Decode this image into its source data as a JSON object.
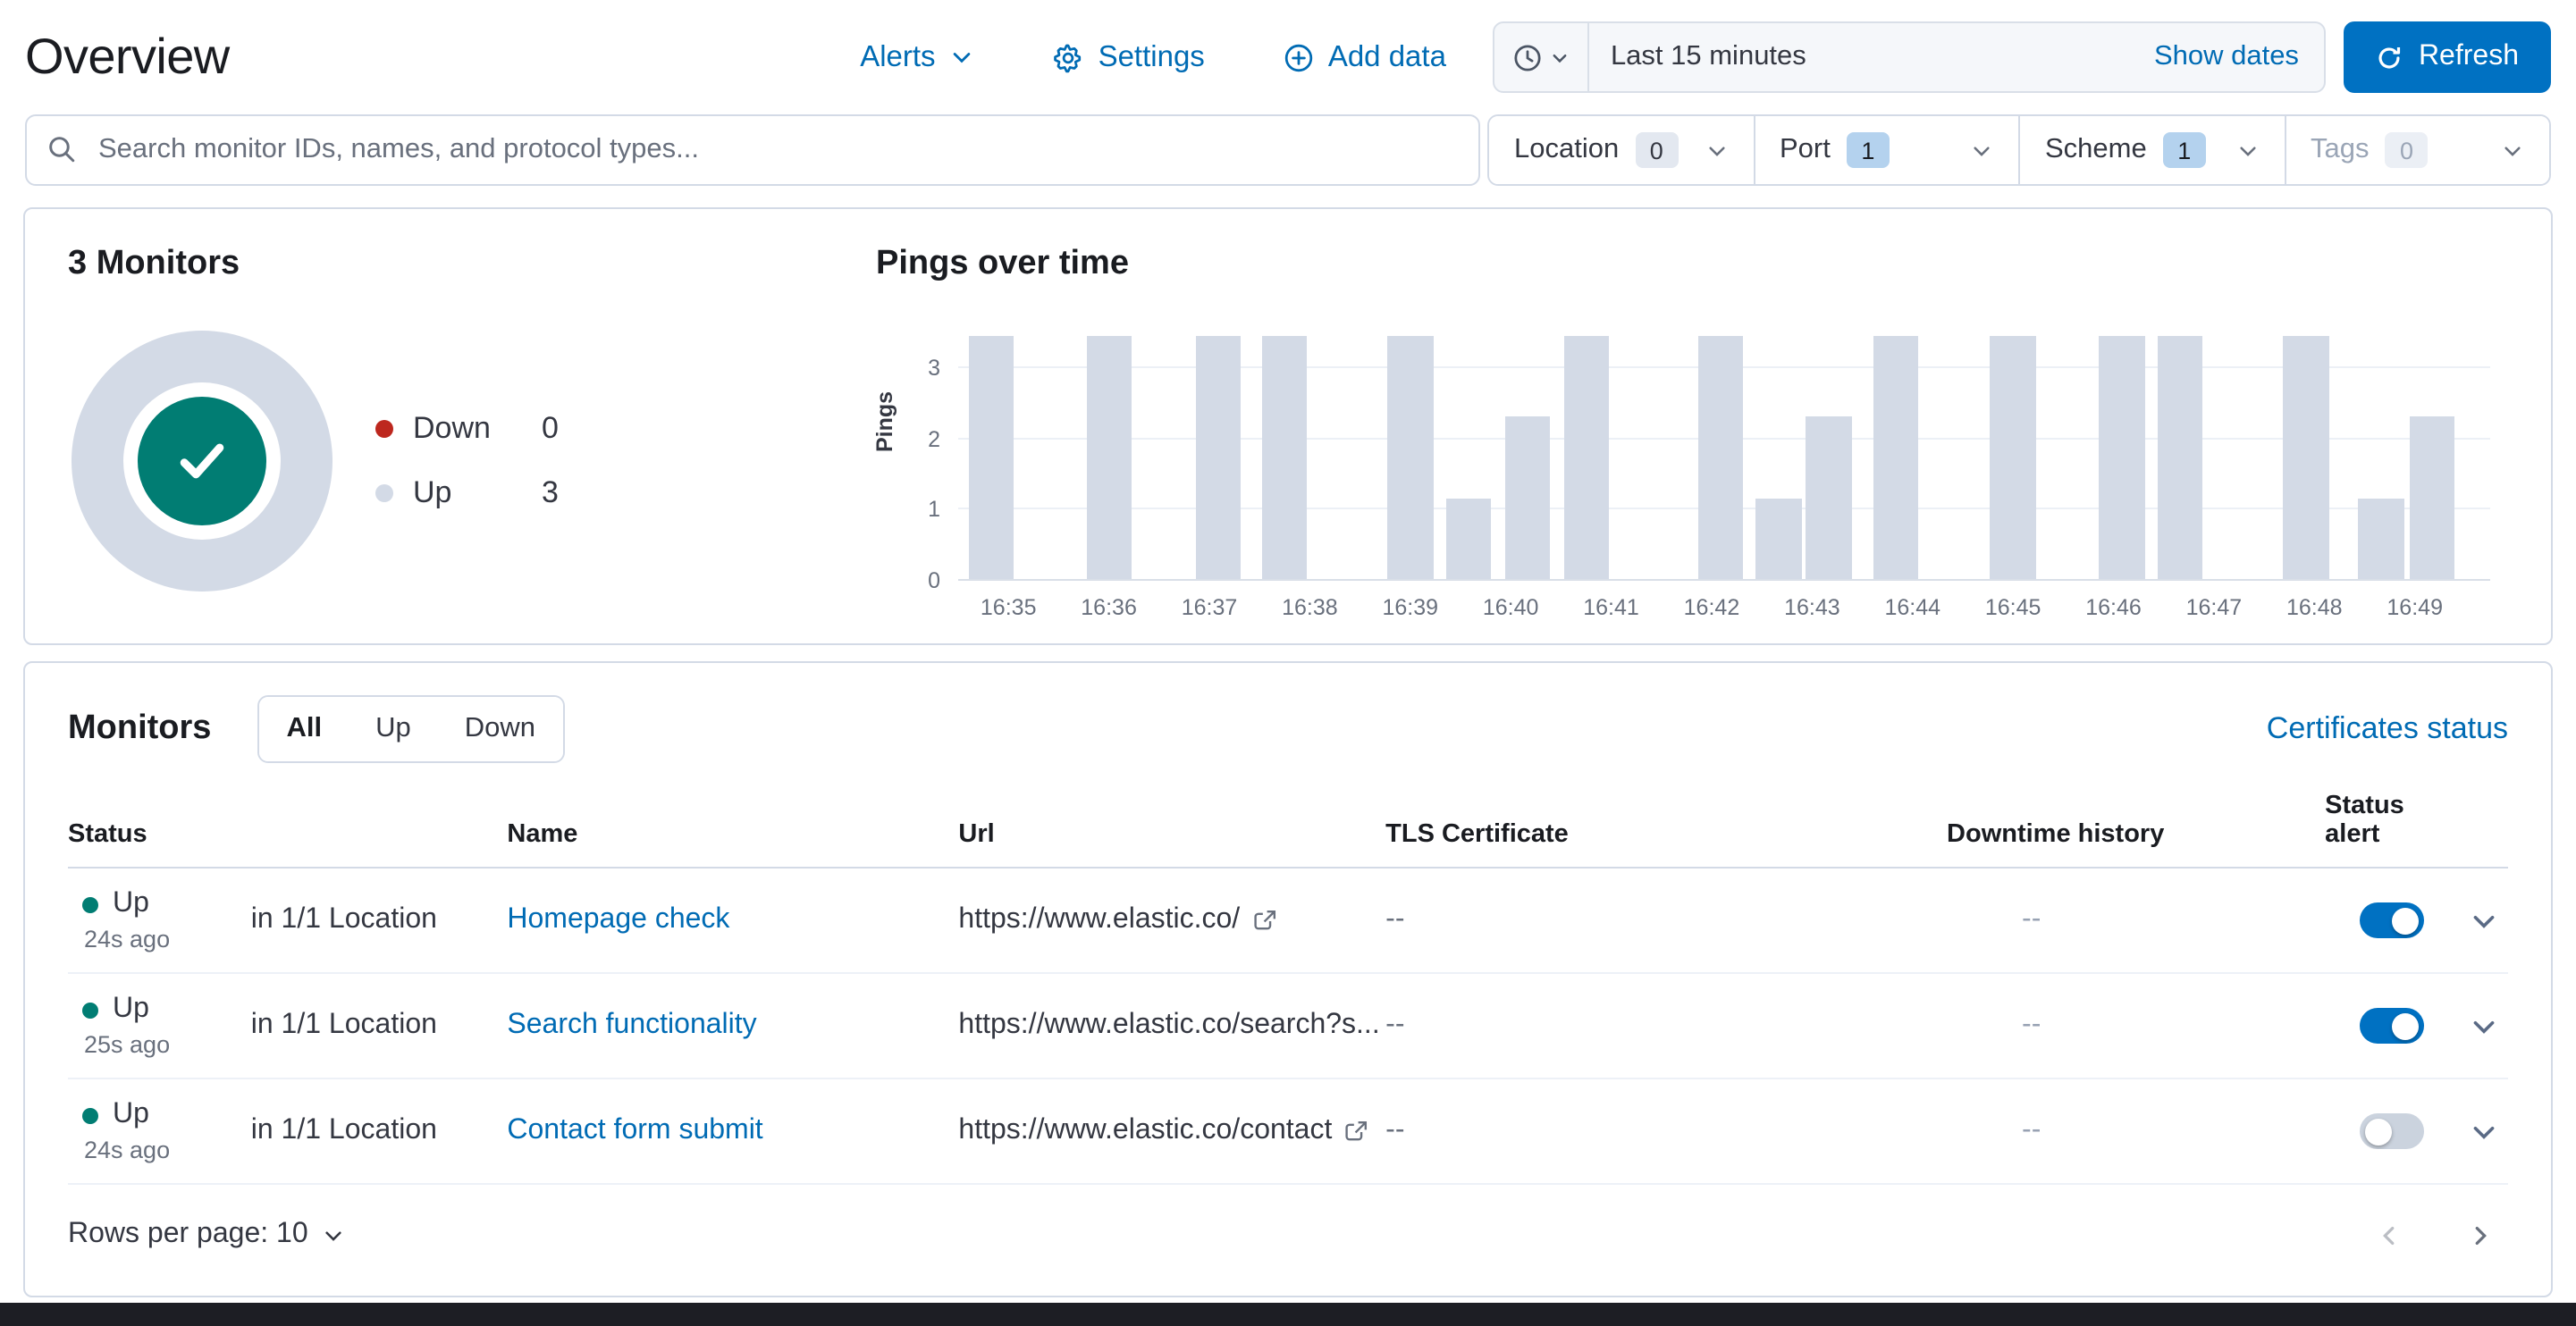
{
  "header": {
    "title": "Overview",
    "alerts_label": "Alerts",
    "settings_label": "Settings",
    "add_data_label": "Add data",
    "time_range": "Last 15 minutes",
    "show_dates_label": "Show dates",
    "refresh_label": "Refresh"
  },
  "search": {
    "placeholder": "Search monitor IDs, names, and protocol types..."
  },
  "filters": [
    {
      "label": "Location",
      "count": "0",
      "active": false,
      "disabled": false
    },
    {
      "label": "Port",
      "count": "1",
      "active": true,
      "disabled": false
    },
    {
      "label": "Scheme",
      "count": "1",
      "active": true,
      "disabled": false
    },
    {
      "label": "Tags",
      "count": "0",
      "active": false,
      "disabled": true
    }
  ],
  "snapshot": {
    "title": "3 Monitors",
    "status_icon": "check-in-circle",
    "status_color": "#017D73",
    "legend": [
      {
        "label": "Down",
        "value": "0",
        "color": "#BD271E"
      },
      {
        "label": "Up",
        "value": "3",
        "color": "#D3DAE6"
      }
    ]
  },
  "chart_data": {
    "type": "bar",
    "title": "Pings over time",
    "ylabel": "Pings",
    "xlabel": "",
    "yticks": [
      0,
      1,
      2,
      3
    ],
    "ylim": [
      0,
      3.43
    ],
    "bar_ylim": 3.0,
    "bar_width_seconds": 27,
    "bar_color": "#D3DAE6",
    "grid": true,
    "x_domain": [
      "16:34:30",
      "16:49:45"
    ],
    "xticks": [
      "16:35",
      "16:36",
      "16:37",
      "16:38",
      "16:39",
      "16:40",
      "16:41",
      "16:42",
      "16:43",
      "16:44",
      "16:45",
      "16:46",
      "16:47",
      "16:48",
      "16:49"
    ],
    "bars": [
      {
        "t": "16:34:50",
        "v": 3
      },
      {
        "t": "16:36:00",
        "v": 3
      },
      {
        "t": "16:37:05",
        "v": 3
      },
      {
        "t": "16:37:45",
        "v": 3
      },
      {
        "t": "16:39:00",
        "v": 3
      },
      {
        "t": "16:39:35",
        "v": 1
      },
      {
        "t": "16:40:10",
        "v": 2
      },
      {
        "t": "16:40:45",
        "v": 3
      },
      {
        "t": "16:42:05",
        "v": 3
      },
      {
        "t": "16:42:40",
        "v": 1
      },
      {
        "t": "16:43:10",
        "v": 2
      },
      {
        "t": "16:43:50",
        "v": 3
      },
      {
        "t": "16:45:00",
        "v": 3
      },
      {
        "t": "16:46:05",
        "v": 3
      },
      {
        "t": "16:46:40",
        "v": 3
      },
      {
        "t": "16:47:55",
        "v": 3
      },
      {
        "t": "16:48:40",
        "v": 1
      },
      {
        "t": "16:49:10",
        "v": 2
      }
    ]
  },
  "monitors": {
    "title": "Monitors",
    "tabs": [
      {
        "label": "All",
        "selected": true
      },
      {
        "label": "Up",
        "selected": false
      },
      {
        "label": "Down",
        "selected": false
      }
    ],
    "certificates_link": "Certificates status",
    "columns": [
      "Status",
      "Name",
      "Url",
      "TLS Certificate",
      "Downtime history",
      "Status alert"
    ],
    "rows": [
      {
        "status": "Up",
        "ago": "24s ago",
        "location": "in 1/1 Location",
        "name": "Homepage check",
        "url": "https://www.elastic.co/",
        "external_icon": true,
        "tls": "--",
        "downtime": "--",
        "alert_on": true
      },
      {
        "status": "Up",
        "ago": "25s ago",
        "location": "in 1/1 Location",
        "name": "Search functionality",
        "url": "https://www.elastic.co/search?s...",
        "external_icon": false,
        "tls": "--",
        "downtime": "--",
        "alert_on": true
      },
      {
        "status": "Up",
        "ago": "24s ago",
        "location": "in 1/1 Location",
        "name": "Contact form submit",
        "url": "https://www.elastic.co/contact",
        "external_icon": true,
        "tls": "--",
        "downtime": "--",
        "alert_on": false
      }
    ],
    "rows_per_page_label": "Rows per page: 10"
  },
  "colors": {
    "primary_button": "#0071C2",
    "link": "#006BB4",
    "status_up": "#017D73",
    "status_down": "#BD271E",
    "bar_fill": "#D3DAE6",
    "panel_border": "#D3DAE6",
    "bottom_bar": "#1D1E24"
  }
}
